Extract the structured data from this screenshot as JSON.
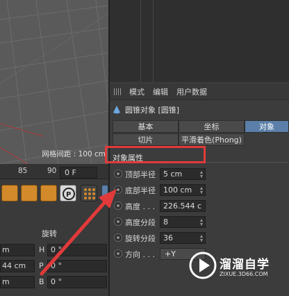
{
  "viewport": {
    "grid_label": "网格间距 : 100 cm"
  },
  "timeline": {
    "ticks": [
      "85",
      "90"
    ],
    "frame": "0 F"
  },
  "attributes": {
    "menu": [
      "模式",
      "编辑",
      "用户数据"
    ],
    "object_title": "圆锥对象 [圆锥]",
    "tabs_row1": [
      "基本",
      "坐标",
      "对象"
    ],
    "tabs_row2": [
      "切片",
      "平滑着色(Phong)"
    ],
    "section": "对象属性",
    "rows": [
      {
        "label": "顶部半径",
        "value": "5 cm"
      },
      {
        "label": "底部半径",
        "value": "100 cm"
      },
      {
        "label": "高度 . . .",
        "value": "226.544 c"
      },
      {
        "label": "高度分段",
        "value": "8"
      },
      {
        "label": "旋转分段",
        "value": "36"
      },
      {
        "label": "方向 . . .",
        "value": "+Y"
      }
    ]
  },
  "coords": {
    "section_label": "旋转",
    "rows": [
      {
        "left": "m",
        "axis": "H",
        "right": "0 °"
      },
      {
        "left": "44 cm",
        "axis": "P",
        "right": "0 °"
      },
      {
        "left": "m",
        "axis": "B",
        "right": "0 °"
      }
    ]
  },
  "watermark": {
    "text": "溜溜自学",
    "sub": "ZIXUE.3D66.COM"
  },
  "colors": {
    "highlight": "#e23a3a",
    "active_tab": "#5b7fa8",
    "tool_orange": "#d28a2a"
  }
}
